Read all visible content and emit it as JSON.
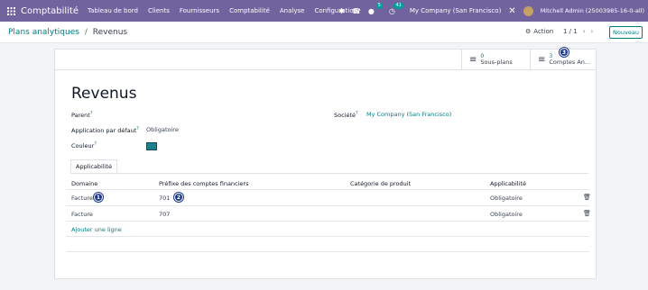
{
  "navbar": {
    "brand": "Comptabilité",
    "menu": [
      "Tableau de bord",
      "Clients",
      "Fournisseurs",
      "Comptabilité",
      "Analyse",
      "Configuration"
    ],
    "messages_badge": "5",
    "activities_badge": "41",
    "company": "My Company (San Francisco)",
    "user": "Mitchell Admin (25003985-16-0-all)",
    "colors": {
      "bar": "#71639e",
      "accent": "#017e84"
    }
  },
  "control_panel": {
    "breadcrumb_parent": "Plans analytiques",
    "breadcrumb_sep": "/",
    "breadcrumb_current": "Revenus",
    "action_label": "Action",
    "pager": "1 / 1",
    "new_label": "Nouveau"
  },
  "smart_buttons": [
    {
      "value": "0",
      "label": "Sous-plans",
      "icon": "list-icon"
    },
    {
      "value": "3",
      "label": "Comptes An...",
      "icon": "list-icon"
    }
  ],
  "form": {
    "title": "Revenus",
    "parent_label": "Parent",
    "parent_value": "",
    "default_app_label": "Application par défaut",
    "default_app_value": "Obligatoire",
    "color_label": "Couleur",
    "color_value": "#1f7f8c",
    "company_label": "Société",
    "company_value": "My Company (San Francisco)",
    "help_mark": "?"
  },
  "tabs": [
    "Applicabilité"
  ],
  "table": {
    "headers": [
      "Domaine",
      "Préfixe des comptes financiers",
      "Catégorie de produit",
      "Applicabilité"
    ],
    "rows": [
      {
        "domain": "Facture",
        "prefix": "701",
        "category": "",
        "applicability": "Obligatoire"
      },
      {
        "domain": "Facture",
        "prefix": "707",
        "category": "",
        "applicability": "Obligatoire"
      }
    ],
    "add_line": "Ajouter une ligne"
  },
  "callouts": [
    "1",
    "2",
    "3"
  ]
}
